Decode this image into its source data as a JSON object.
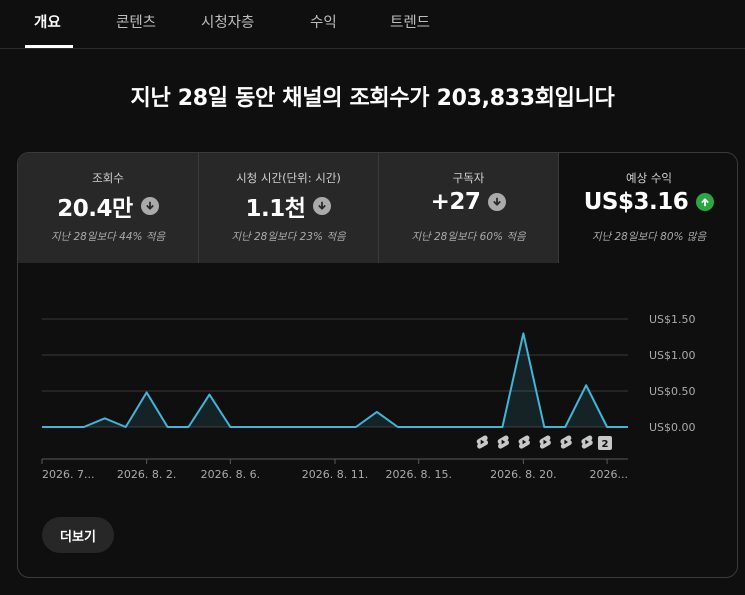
{
  "tabs": [
    {
      "label": "개요",
      "active": true
    },
    {
      "label": "콘텐츠",
      "active": false
    },
    {
      "label": "시청자층",
      "active": false
    },
    {
      "label": "수익",
      "active": false
    },
    {
      "label": "트렌드",
      "active": false
    }
  ],
  "headline": "지난 28일 동안 채널의 조회수가 203,833회입니다",
  "metrics": [
    {
      "label": "조회수",
      "value": "20.4만",
      "trend": "down",
      "comparison": "지난 28일보다 44% 적음"
    },
    {
      "label": "시청 시간(단위: 시간)",
      "value": "1.1천",
      "trend": "down",
      "comparison": "지난 28일보다 23% 적음"
    },
    {
      "label": "구독자",
      "value": "+27",
      "trend": "down",
      "comparison": "지난 28일보다 60% 적음"
    },
    {
      "label": "예상 수익",
      "value": "US$3.16",
      "trend": "up",
      "comparison": "지난 28일보다 80% 많음"
    }
  ],
  "colors": {
    "line": "#41b4d8",
    "trend_down": "#aaaaaa",
    "trend_up": "#2ba640",
    "grid": "#3a3a3a"
  },
  "chart_data": {
    "type": "line",
    "series": [
      {
        "values": [
          0,
          0,
          0,
          0.12,
          0,
          0.48,
          0,
          0,
          0.45,
          0,
          0,
          0,
          0,
          0,
          0,
          0,
          0.21,
          0,
          0,
          0,
          0,
          0,
          0,
          1.3,
          0,
          0,
          0.58,
          0,
          0
        ]
      }
    ],
    "ylim": [
      0,
      1.5
    ],
    "yticks": [
      "US$0.00",
      "US$0.50",
      "US$1.00",
      "US$1.50"
    ],
    "ytick_values": [
      0,
      0.5,
      1.0,
      1.5
    ],
    "xticks": [
      {
        "label": "2026. 7...",
        "index": 0
      },
      {
        "label": "2026. 8. 2.",
        "index": 5
      },
      {
        "label": "2026. 8. 6.",
        "index": 9
      },
      {
        "label": "2026. 8. 11.",
        "index": 14
      },
      {
        "label": "2026. 8. 15.",
        "index": 18
      },
      {
        "label": "2026. 8. 20.",
        "index": 23
      },
      {
        "label": "2026...",
        "index": 27
      }
    ],
    "markers": [
      {
        "index": 21,
        "icon": "shorts-icon"
      },
      {
        "index": 22,
        "icon": "shorts-icon"
      },
      {
        "index": 23,
        "icon": "shorts-icon"
      },
      {
        "index": 24,
        "icon": "shorts-icon"
      },
      {
        "index": 25,
        "icon": "shorts-icon"
      },
      {
        "index": 26,
        "icon": "shorts-icon"
      },
      {
        "index": 26.9,
        "badge": "2"
      }
    ]
  },
  "more_button": "더보기"
}
